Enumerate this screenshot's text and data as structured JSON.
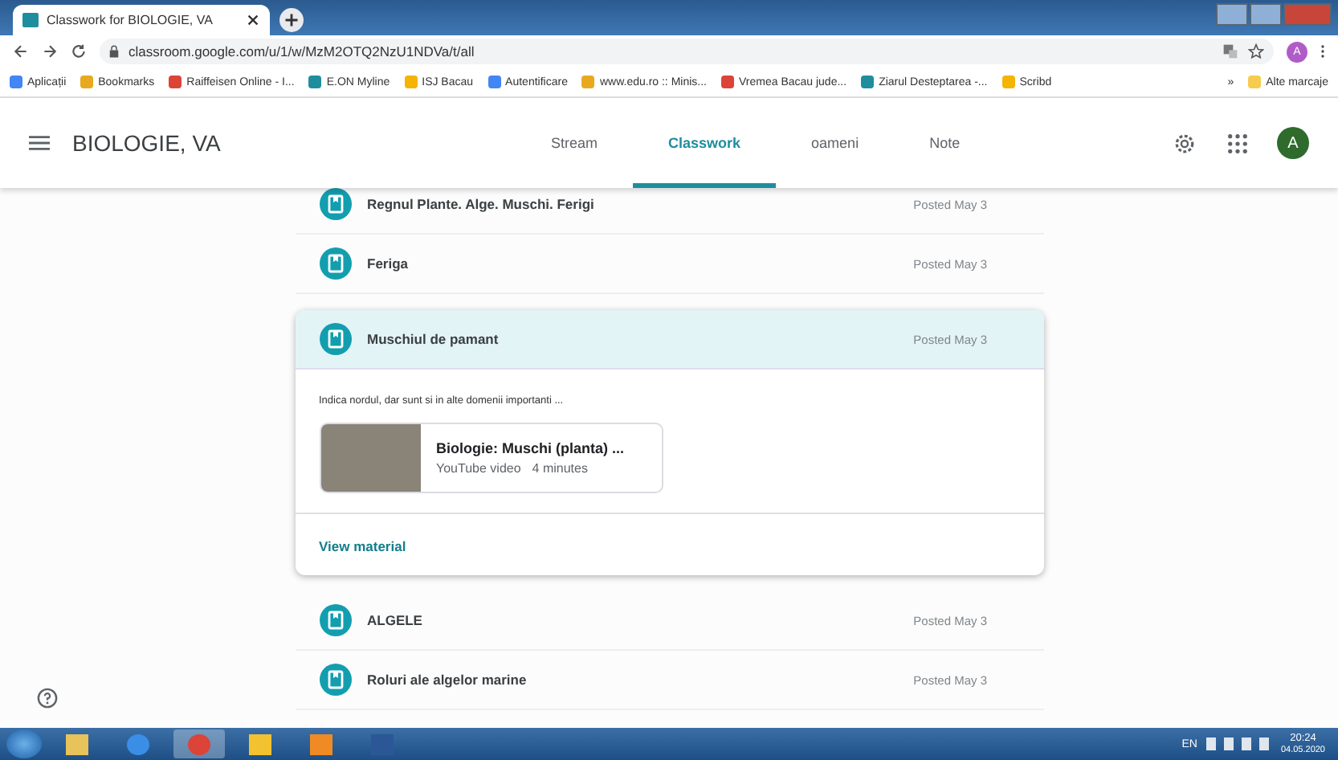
{
  "browser": {
    "tab_title": "Classwork for BIOLOGIE, VA",
    "url": "classroom.google.com/u/1/w/MzM2OTQ2NzU1NDVa/t/all",
    "profile_initial": "A",
    "bookmarks": [
      "Aplicații",
      "Bookmarks",
      "Raiffeisen Online - I...",
      "E.ON Myline",
      "ISJ Bacau",
      "Autentificare",
      "www.edu.ro :: Minis...",
      "Vremea Bacau jude...",
      "Ziarul Desteptarea -...",
      "Scribd"
    ],
    "overflow": "»",
    "other_bookmarks": "Alte marcaje"
  },
  "header": {
    "class_name": "BIOLOGIE, VA",
    "avatar_initial": "A",
    "tabs": [
      {
        "label": "Stream",
        "selected": false
      },
      {
        "label": "Classwork",
        "selected": true
      },
      {
        "label": "oameni",
        "selected": false
      },
      {
        "label": "Note",
        "selected": false
      }
    ]
  },
  "materials": [
    {
      "title": "Regnul Plante. Alge. Muschi. Ferigi",
      "posted": "Posted May 3",
      "expanded": false
    },
    {
      "title": "Feriga",
      "posted": "Posted May 3",
      "expanded": false
    },
    {
      "title": "Muschiul de pamant",
      "posted": "Posted May 3",
      "expanded": true,
      "description": "Indica nordul, dar sunt si in alte domenii importanti ...",
      "attachment": {
        "title": "Biologie: Muschi (planta) ...",
        "source": "YouTube video",
        "duration": "4 minutes"
      },
      "action": "View material"
    },
    {
      "title": "ALGELE",
      "posted": "Posted May 3",
      "expanded": false
    },
    {
      "title": "Roluri ale algelor marine",
      "posted": "Posted May 3",
      "expanded": false
    }
  ],
  "taskbar": {
    "language": "EN",
    "time": "20:24",
    "date": "04.05.2020"
  }
}
